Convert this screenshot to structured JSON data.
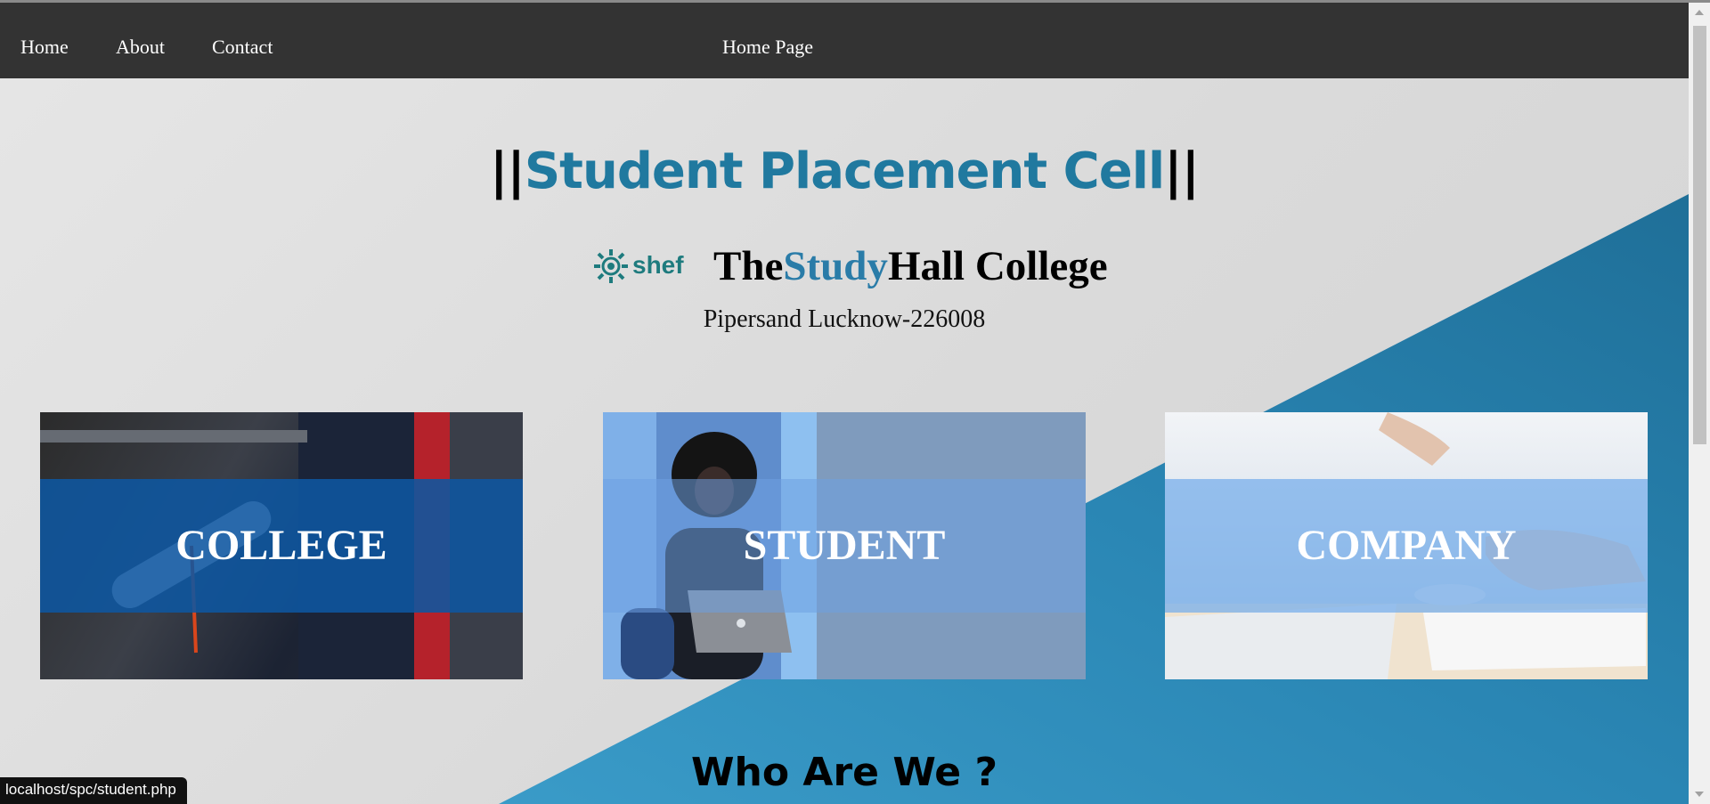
{
  "nav": {
    "links": [
      "Home",
      "About",
      "Contact"
    ],
    "page_title": "Home Page"
  },
  "hero": {
    "bars_left": "||",
    "title": "Student Placement Cell",
    "bars_right": "||",
    "logo_text": "shef",
    "college_the": "The",
    "college_study": "Study",
    "college_rest": "Hall College",
    "address": "Pipersand Lucknow-226008"
  },
  "cards": [
    {
      "label": "COLLEGE"
    },
    {
      "label": "STUDENT"
    },
    {
      "label": "COMPANY"
    }
  ],
  "section": {
    "who_title": "Who Are We ?"
  },
  "status_bar": {
    "url": "localhost/spc/student.php"
  },
  "colors": {
    "navbar": "#333333",
    "accent_blue": "#20799f",
    "diagonal_blue": "#2780ad"
  }
}
